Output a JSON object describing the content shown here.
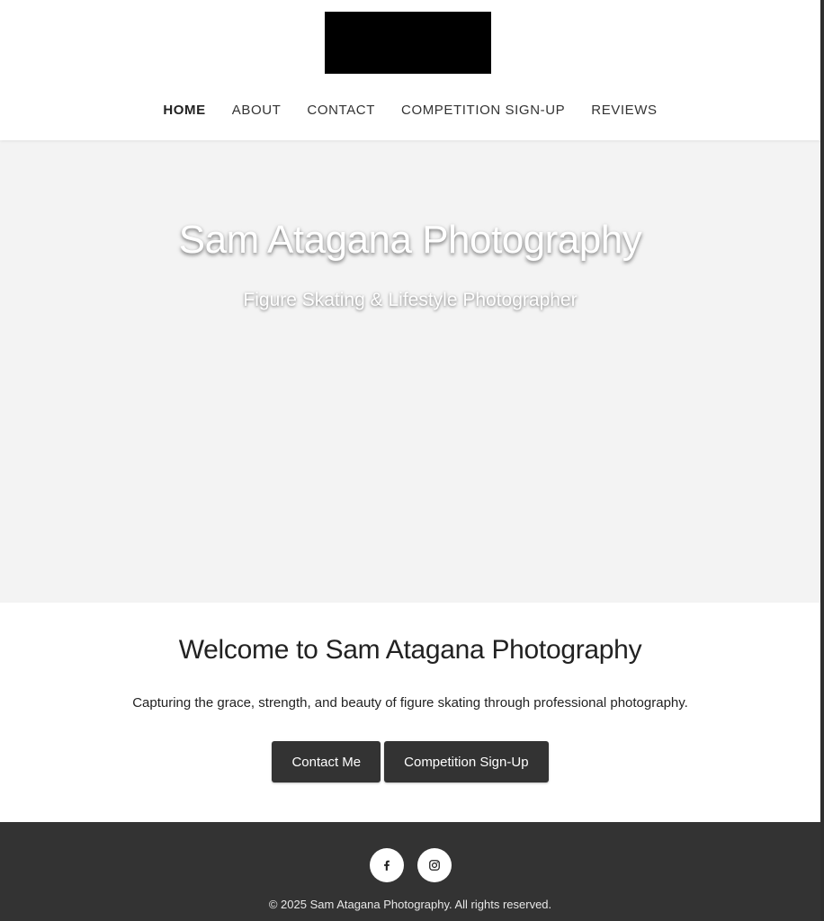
{
  "nav": {
    "items": [
      {
        "label": "HOME",
        "active": true
      },
      {
        "label": "ABOUT"
      },
      {
        "label": "CONTACT"
      },
      {
        "label": "COMPETITION SIGN-UP"
      },
      {
        "label": "REVIEWS"
      }
    ]
  },
  "hero": {
    "title": "Sam Atagana Photography",
    "subtitle": "Figure Skating & Lifestyle Photographer"
  },
  "welcome": {
    "title": "Welcome to Sam Atagana Photography",
    "text": "Capturing the grace, strength, and beauty of figure skating through professional photography.",
    "contact_button": "Contact Me",
    "signup_button": "Competition Sign-Up"
  },
  "footer": {
    "social": [
      "facebook-icon",
      "instagram-icon"
    ],
    "copyright": "© 2025 Sam Atagana Photography. All rights reserved."
  },
  "colors": {
    "dark": "#333333",
    "hero_bg": "#f3f3f3"
  }
}
